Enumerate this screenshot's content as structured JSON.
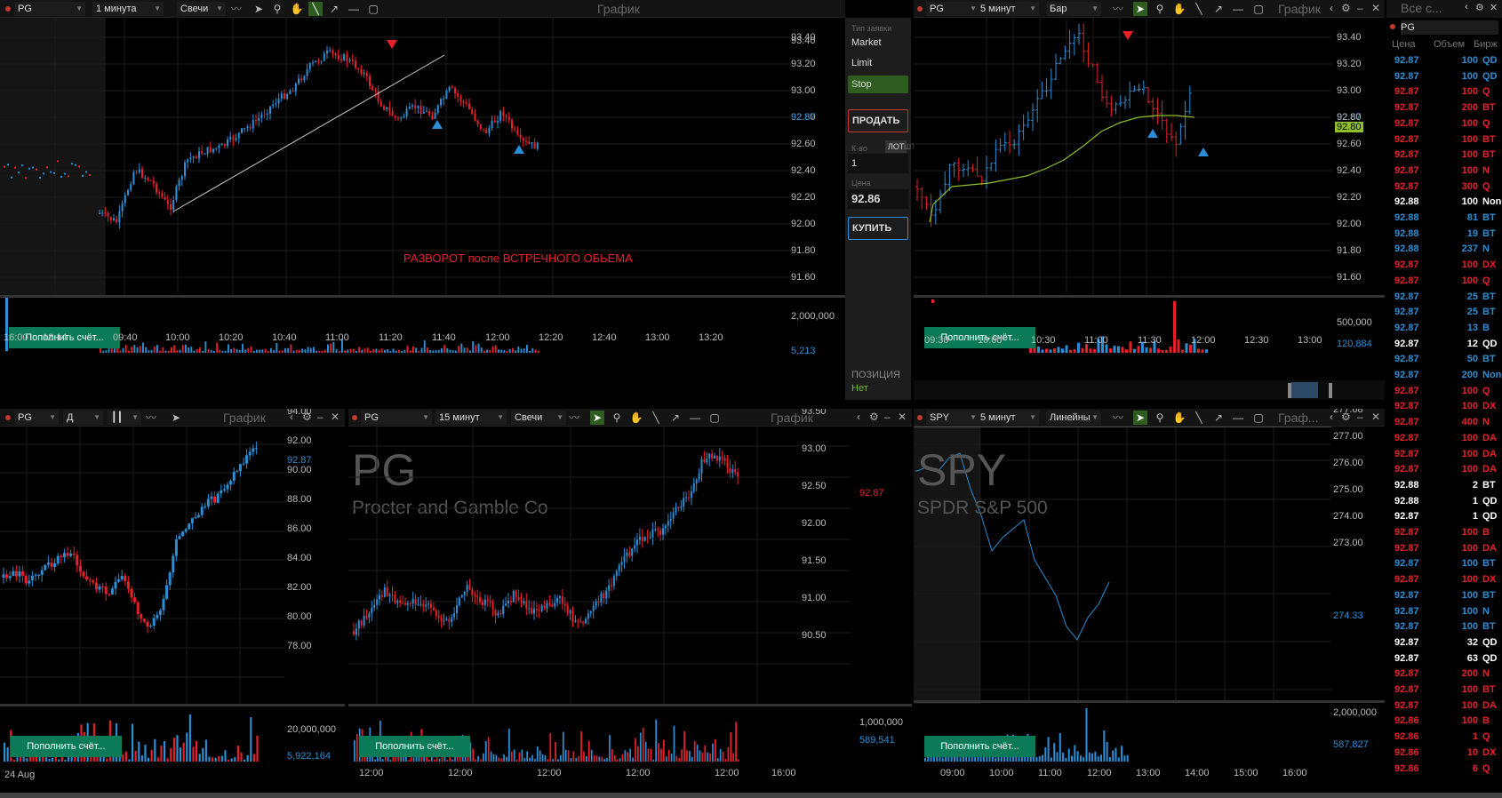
{
  "chart1": {
    "symbol": "PG",
    "interval": "1 минута",
    "type": "Свечи",
    "title": "График",
    "y_labels": [
      "93.40",
      "93.20",
      "93.00",
      "92.80",
      "92.60",
      "92.40",
      "92.20",
      "92.00",
      "91.80",
      "91.60"
    ],
    "last": "92.87",
    "annotation": "РАЗВОРОТ после ВСТРЕЧНОГО ОБЬЕМА",
    "vol_labels": [
      "2,000,000",
      "5,213"
    ],
    "x_labels": [
      "16:00",
      "18:14",
      "09:40",
      "10:00",
      "10:20",
      "10:40",
      "11:00",
      "11:20",
      "11:40",
      "12:00",
      "12:20",
      "12:40",
      "13:00",
      "13:20"
    ]
  },
  "order": {
    "type_label": "Тип заявки",
    "types": [
      "Market",
      "Limit",
      "Stop"
    ],
    "sell": "ПРОДАТЬ",
    "qty_label": "К-во",
    "lot": "ЛОТ",
    "sht": "ШТ",
    "qty": "1",
    "price_label": "Цена",
    "price": "92.86",
    "buy": "КУПИТЬ",
    "pos_label": "ПОЗИЦИЯ",
    "pos_val": "Нет"
  },
  "chart2": {
    "symbol": "PG",
    "interval": "5 минут",
    "type": "Бар",
    "title": "График",
    "y_labels": [
      "93.40",
      "93.20",
      "93.00",
      "92.80",
      "92.60",
      "92.40",
      "92.20",
      "92.00",
      "91.80",
      "91.60"
    ],
    "last": "92.87",
    "ma_val": "92.80",
    "vol_labels": [
      "500,000",
      "120,884"
    ],
    "x_labels": [
      "09:30",
      "10:00",
      "10:30",
      "11:00",
      "11:30",
      "12:00",
      "12:30",
      "13:00"
    ]
  },
  "chart3": {
    "symbol": "PG",
    "interval": "Д",
    "title": "График",
    "y_labels": [
      "94.00",
      "92.00",
      "90.00",
      "88.00",
      "86.00",
      "84.00",
      "82.00",
      "80.00",
      "78.00"
    ],
    "last": "92.87",
    "vol_labels": [
      "20,000,000",
      "5,922,164"
    ],
    "x_labels": [
      "24 Aug"
    ]
  },
  "chart4": {
    "symbol": "PG",
    "interval": "15 минут",
    "type": "Свечи",
    "title": "График",
    "ticker": "PG",
    "company": "Procter and Gamble Co",
    "y_labels": [
      "93.50",
      "93.00",
      "92.50",
      "92.00",
      "91.50",
      "91.00",
      "90.50"
    ],
    "last": "92.87",
    "vol_labels": [
      "1,000,000",
      "589,541"
    ],
    "x_labels": [
      "12:00",
      "12:00",
      "12:00",
      "12:00",
      "12:00",
      "16:00"
    ]
  },
  "chart5": {
    "symbol": "SPY",
    "interval": "5 минут",
    "type": "Линейны",
    "title": "Граф...",
    "ticker": "SPY",
    "company": "SPDR S&P 500",
    "y_labels": [
      "277.68",
      "277.00",
      "276.00",
      "275.00",
      "274.00",
      "273.00"
    ],
    "last": "274.33",
    "vol_labels": [
      "2,000,000",
      "587,827"
    ],
    "x_labels": [
      "09:00",
      "10:00",
      "11:00",
      "12:00",
      "13:00",
      "14:00",
      "15:00",
      "16:00"
    ]
  },
  "deposit": "Пополнить счёт...",
  "tape": {
    "filter": "Все с...",
    "symbol": "PG",
    "headers": [
      "Цена",
      "Объем",
      "Бирж"
    ],
    "rows": [
      [
        "92.87",
        "100",
        "QD",
        "b"
      ],
      [
        "92.87",
        "100",
        "QD",
        "b"
      ],
      [
        "92.87",
        "100",
        "Q",
        "r"
      ],
      [
        "92.87",
        "200",
        "BT",
        "r"
      ],
      [
        "92.87",
        "100",
        "Q",
        "r"
      ],
      [
        "92.87",
        "100",
        "BT",
        "r"
      ],
      [
        "92.87",
        "100",
        "BT",
        "r"
      ],
      [
        "92.87",
        "100",
        "N",
        "r"
      ],
      [
        "92.87",
        "300",
        "Q",
        "r"
      ],
      [
        "92.88",
        "100",
        "None",
        "w"
      ],
      [
        "92.88",
        "81",
        "BT",
        "b"
      ],
      [
        "92.88",
        "19",
        "BT",
        "b"
      ],
      [
        "92.88",
        "237",
        "N",
        "b"
      ],
      [
        "92.87",
        "100",
        "DX",
        "r"
      ],
      [
        "92.87",
        "100",
        "Q",
        "r"
      ],
      [
        "92.87",
        "25",
        "BT",
        "b"
      ],
      [
        "92.87",
        "25",
        "BT",
        "b"
      ],
      [
        "92.87",
        "13",
        "B",
        "b"
      ],
      [
        "92.87",
        "12",
        "QD",
        "w"
      ],
      [
        "92.87",
        "50",
        "BT",
        "b"
      ],
      [
        "92.87",
        "200",
        "None",
        "b"
      ],
      [
        "92.87",
        "100",
        "Q",
        "r"
      ],
      [
        "92.87",
        "100",
        "DX",
        "r"
      ],
      [
        "92.87",
        "400",
        "N",
        "r"
      ],
      [
        "92.87",
        "100",
        "DA",
        "r"
      ],
      [
        "92.87",
        "100",
        "DA",
        "r"
      ],
      [
        "92.87",
        "100",
        "DA",
        "r"
      ],
      [
        "92.88",
        "2",
        "BT",
        "w"
      ],
      [
        "92.88",
        "1",
        "QD",
        "w"
      ],
      [
        "92.87",
        "1",
        "QD",
        "w"
      ],
      [
        "92.87",
        "100",
        "B",
        "r"
      ],
      [
        "92.87",
        "100",
        "DA",
        "r"
      ],
      [
        "92.87",
        "100",
        "BT",
        "b"
      ],
      [
        "92.87",
        "100",
        "DX",
        "r"
      ],
      [
        "92.87",
        "100",
        "BT",
        "b"
      ],
      [
        "92.87",
        "100",
        "N",
        "b"
      ],
      [
        "92.87",
        "100",
        "BT",
        "b"
      ],
      [
        "92.87",
        "32",
        "QD",
        "w"
      ],
      [
        "92.87",
        "63",
        "QD",
        "w"
      ],
      [
        "92.87",
        "200",
        "N",
        "r"
      ],
      [
        "92.87",
        "100",
        "BT",
        "r"
      ],
      [
        "92.87",
        "100",
        "DA",
        "r"
      ],
      [
        "92.86",
        "100",
        "B",
        "r"
      ],
      [
        "92.86",
        "1",
        "Q",
        "r"
      ],
      [
        "92.86",
        "10",
        "DX",
        "r"
      ],
      [
        "92.86",
        "6",
        "Q",
        "r"
      ]
    ]
  },
  "colors": {
    "up": "#2a8fd6",
    "down": "#e8202a",
    "accent": "#2e5d1f",
    "deposit": "#0b7a57",
    "ma": "#8fbf2a"
  }
}
